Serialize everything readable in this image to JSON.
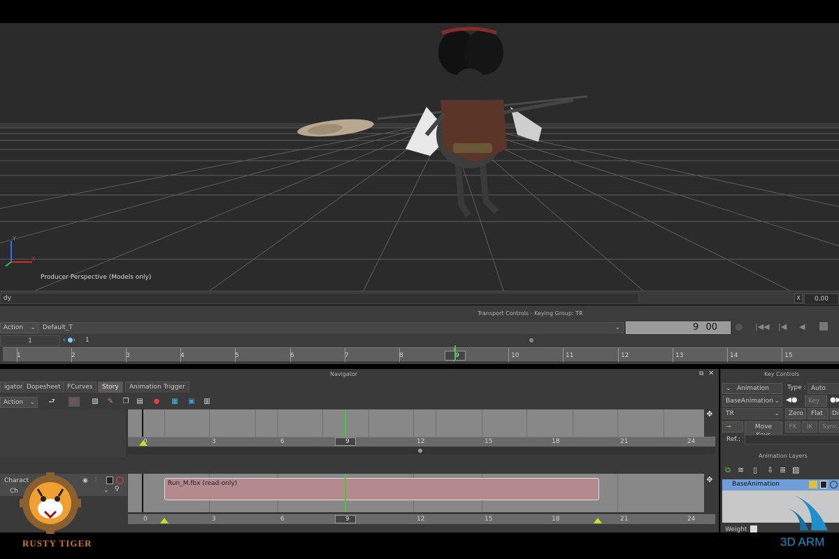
{
  "viewport": {
    "camera_label": "Producer Perspective (Models only)",
    "axis": {
      "y": "Y",
      "x": "X"
    }
  },
  "status": {
    "message": "dy",
    "value": "0.00",
    "checkbox": "X"
  },
  "transport": {
    "title": "Transport Controls  -  Keying Group: TR",
    "mode": "Action",
    "take": "Default_T",
    "current_frame": "9",
    "current_frame_sub": "00",
    "field_a": "1",
    "field_b": "1",
    "ruler_labels": [
      "1",
      "2",
      "3",
      "4",
      "5",
      "6",
      "7",
      "8",
      "9",
      "10",
      "11",
      "12",
      "13",
      "14",
      "15"
    ],
    "playhead_label": "9"
  },
  "navigator": {
    "title": "Navigator",
    "tabs": [
      "igator",
      "Dopesheet",
      "FCurves",
      "Story",
      "Animation Trigger"
    ],
    "active_tab": "Story",
    "mode": "Action",
    "track1_labels": [
      "0",
      "3",
      "6",
      "9",
      "12",
      "15",
      "18",
      "21",
      "24"
    ],
    "track2_labels": [
      "0",
      "3",
      "6",
      "9",
      "12",
      "15",
      "18",
      "21",
      "24"
    ],
    "track_name": "Charact",
    "track_sub": "Ch",
    "clip_label": "Run_M.fbx (read-only)"
  },
  "key_controls": {
    "title": "Key Controls",
    "animation_label": "Animation",
    "type_label": "Type :",
    "type_value": "Auto",
    "layer_select": "BaseAnimation",
    "key_button": "Key",
    "tr_select": "TR",
    "zero_button": "Zero",
    "flat_button": "Flat",
    "di_button": "Di",
    "move_keys": "Move Keys",
    "fk_button": "FK",
    "ik_button": "IK",
    "sync_button": "Sync.",
    "ref_label": "Ref.:",
    "layers_title": "Animation Layers",
    "base_layer": "BaseAnimation",
    "weight_label": "Weight"
  },
  "branding": {
    "left_logo_text": "RUSTY TIGER",
    "right_logo_text": "3D ARM"
  },
  "colors": {
    "viewport_bg": "#2b2b2b",
    "playhead": "#36d030",
    "clip_fill": "#b58a8e",
    "layer_highlight": "#6f9ed8",
    "key_marker": "#c8e020"
  }
}
